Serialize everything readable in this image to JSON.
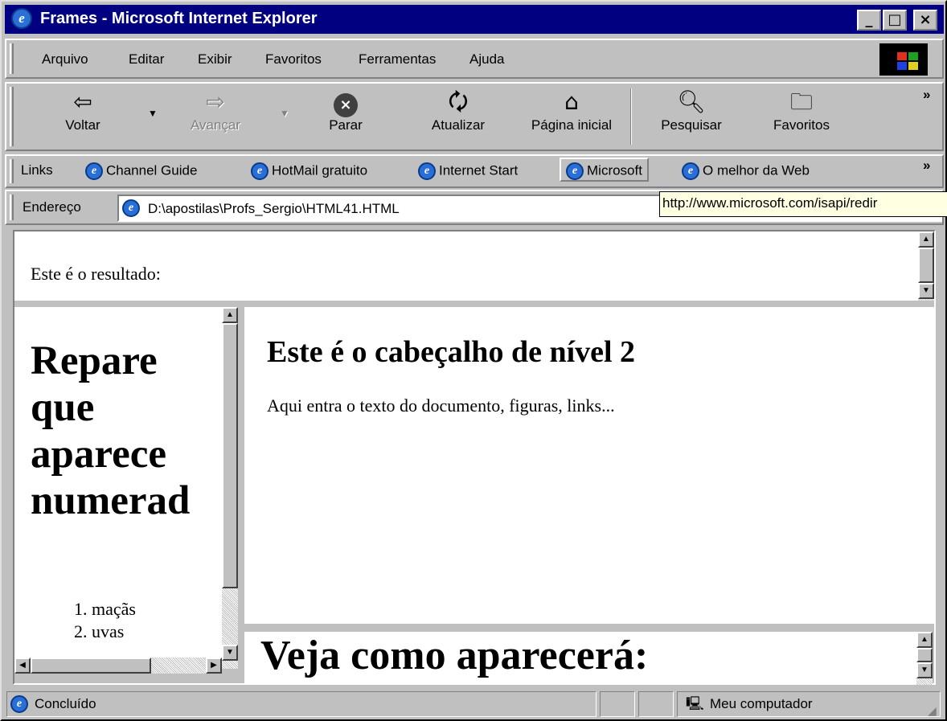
{
  "window": {
    "title": "Frames - Microsoft Internet Explorer",
    "controls": {
      "minimize": "_",
      "maximize": "□",
      "close": "×"
    }
  },
  "menu": [
    "Arquivo",
    "Editar",
    "Exibir",
    "Favoritos",
    "Ferramentas",
    "Ajuda"
  ],
  "toolbar": {
    "back": "Voltar",
    "forward": "Avançar",
    "stop": "Parar",
    "refresh": "Atualizar",
    "home": "Página inicial",
    "search": "Pesquisar",
    "favorites": "Favoritos",
    "more": "»"
  },
  "links": {
    "label": "Links",
    "items": [
      "Channel Guide",
      "HotMail gratuito",
      "Internet Start",
      "Microsoft",
      "O melhor da Web"
    ],
    "more": "»"
  },
  "address": {
    "label": "Endereço",
    "value": "D:\\apostilas\\Profs_Sergio\\HTML41.HTML"
  },
  "tooltip": "http://www.microsoft.com/isapi/redir",
  "frames": {
    "top": {
      "text": "Este é o resultado:"
    },
    "left": {
      "heading_lines": [
        "Repare",
        "que",
        "aparece",
        "numerad"
      ],
      "list": [
        "maçãs",
        "uvas"
      ]
    },
    "main": {
      "heading": "Este é o cabeçalho de nível 2",
      "paragraph": "Aqui entra o texto do documento, figuras, links..."
    },
    "bottom": {
      "heading": "Veja como aparecerá:"
    }
  },
  "status": {
    "text": "Concluído",
    "zone": "Meu computador"
  },
  "colors": {
    "titlebar": "#000080",
    "chrome": "#c0c0c0",
    "tooltip": "#ffffe1"
  }
}
